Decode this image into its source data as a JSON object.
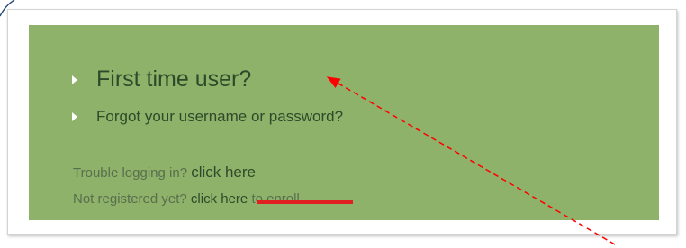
{
  "panel": {
    "first_time_link": "First time user?",
    "forgot_link": "Forgot your username or password?",
    "trouble_prefix": "Trouble logging in?",
    "trouble_link": "click here",
    "register_prefix": "Not registered yet?",
    "register_link": "click here",
    "register_suffix": "to enroll"
  },
  "colors": {
    "panel_background": "#8eb26a",
    "link_text": "#2f4a2a",
    "muted_text": "#586f4d",
    "annotation_arrow": "#ff0000",
    "strike_bar": "#e02020"
  }
}
